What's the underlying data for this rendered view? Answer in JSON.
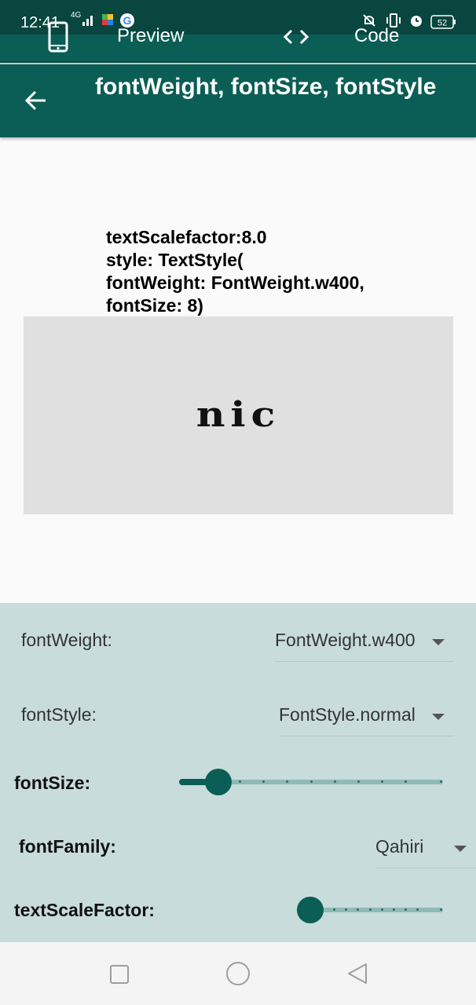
{
  "status": {
    "time": "12:41",
    "network": "4G",
    "battery": "52",
    "icons": [
      "signal-icon",
      "puzzle-icon",
      "google-icon",
      "mute-icon",
      "vibrate-icon",
      "alarm-icon",
      "battery-icon"
    ]
  },
  "tabs": {
    "preview_label": "Preview",
    "code_label": "Code",
    "preview_icon": "phone-icon",
    "code_icon": "code-brackets-icon"
  },
  "appbar": {
    "title": "fontWeight, fontSize, fontStyle",
    "back_icon": "arrow-back-icon"
  },
  "preview": {
    "description": "textScalefactor:8.0\nstyle: TextStyle(\nfontWeight: FontWeight.w400,\nfontSize: 8)",
    "sample_text": "nic",
    "box_color": "#e0e0e0"
  },
  "controls": {
    "font_weight": {
      "label": "fontWeight:",
      "value": "FontWeight.w400"
    },
    "font_style": {
      "label": "fontStyle:",
      "value": "FontStyle.normal"
    },
    "font_size": {
      "label": "fontSize:",
      "fraction": 0.11,
      "divisions": 10
    },
    "font_family": {
      "label": "fontFamily:",
      "value": "Qahiri"
    },
    "text_scale_factor": {
      "label": "textScaleFactor:",
      "fraction": 0.0,
      "divisions": 10
    }
  },
  "colors": {
    "primary": "#0b5e55",
    "panel": "#c8dcdb",
    "slider_inactive": "#8fbab6"
  },
  "navbar": {
    "icons": [
      "recents-square-icon",
      "home-circle-icon",
      "back-triangle-icon"
    ]
  }
}
